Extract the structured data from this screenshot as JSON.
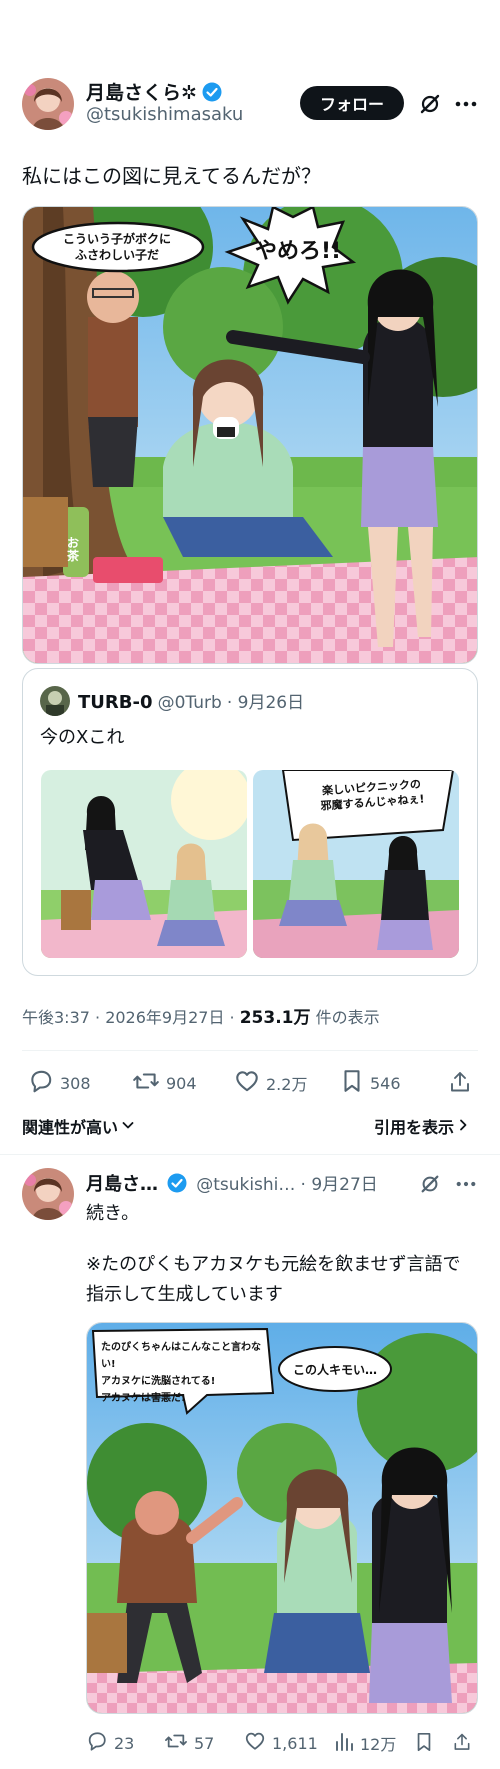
{
  "main_post": {
    "author_name": "月島さくら✲",
    "author_handle": "@tsukishimasaku",
    "follow_label": "フォロー",
    "text": "私にはこの図に見えてるんだが？",
    "image": {
      "bubble_left": "こういう子がボクに\nふさわしい子だ",
      "bubble_right": "やめろ!!",
      "bottle_label": "お茶"
    },
    "quote": {
      "author_name": "TURB-0",
      "author_handle": "@0Turb",
      "date": "· 9月26日",
      "text": "今のXこれ",
      "image_right_caption": "楽しいピクニックの\n邪魔するんじゃねぇ!"
    },
    "timestamp": "午後3:37 · 2026年9月27日 · ",
    "views_count": "253.1万",
    "views_label": " 件の表示",
    "stats": {
      "replies": "308",
      "reposts": "904",
      "likes": "2.2万",
      "bookmarks": "546"
    },
    "sort_label": "関連性が高い",
    "quotes_link": "引用を表示"
  },
  "reply_post": {
    "author_name": "月島さ…",
    "author_handle": "@tsukishi…",
    "date": "· 9月27日",
    "text1": "続き。",
    "text2": "※たのぴくもアカヌケも元絵を飲ませず言語で指示して生成しています",
    "image": {
      "bubble_left": "たのぴくちゃんはこんなこと言わない!\nアカヌケに洗脳されてる!\nアカヌケは害悪だ!",
      "bubble_right": "この人キモい…"
    },
    "stats": {
      "replies": "23",
      "reposts": "57",
      "likes": "1,611",
      "views": "12万"
    }
  },
  "colors": {
    "accent": "#1d9bf0",
    "text": "#0f1419",
    "muted": "#536471",
    "border": "#cfd9de"
  }
}
